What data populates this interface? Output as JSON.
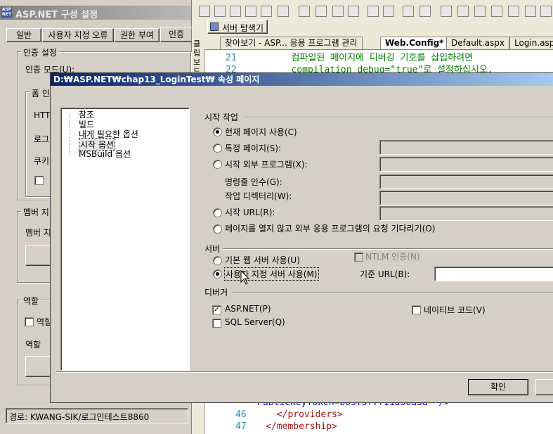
{
  "bg_window": {
    "title": "ASP.NET 구성 설정",
    "tabs": [
      "일반",
      "사용자 지정 오류",
      "권한 부여",
      "인증"
    ],
    "auth_group": "인증 설정",
    "auth_mode_label": "인증 모드(U):",
    "form_group_partial": "폼 인",
    "http_partial": "HTT",
    "login_partial": "로그",
    "cookie_partial": "쿠키",
    "member_group_partial": "멤버 지",
    "member_label_partial": "멤버 지",
    "role_group_partial": "역할",
    "role_check_partial": "역할",
    "role_label_partial": "역할 ",
    "path_status": "경로: KWANG-SIK/로그인테스트8860"
  },
  "editor": {
    "server_explorer_btn": "서버 탐색기",
    "side_label": "클립보드",
    "tabs": [
      "찾아보기 - ASP... 응용 프로그램 관리",
      "Web.Config*",
      "Default.aspx",
      "Login.asp"
    ],
    "top_lines": [
      {
        "num": "21",
        "text": "컴파일된 페이지에 디버깅 기호를 삽입하려면"
      },
      {
        "num": "22",
        "text": "compilation debug=\"true\"로 설정하십시오."
      }
    ],
    "bottom_lines": [
      {
        "num": "",
        "text": "PublicKeyToken=b03f5f7f11d50a3a\" />"
      },
      {
        "num": "46",
        "text": "    </providers>"
      },
      {
        "num": "47",
        "text": "  </membership>"
      }
    ]
  },
  "dialog": {
    "title": "D:₩ASP.NET₩chap13_LoginTest₩ 속성 페이지",
    "tree": [
      "참조",
      "빌드",
      "내게 필요한 옵션",
      "시작 옵션",
      "MSBuild 옵션"
    ],
    "selected_tree_index": 3,
    "start_group": "시작 작업",
    "opt_current": "현재 페이지 사용(C)",
    "opt_specific": "특정 페이지(S):",
    "opt_external": "시작 외부 프로그램(X):",
    "cmd_args": "명령줄 인수(G):",
    "work_dir": "작업 디렉터리(W):",
    "opt_url": "시작 URL(R):",
    "opt_wait": "페이지를 열지 않고 외부 응용 프로그램의 요청 기다리기(O)",
    "server_group": "서버",
    "opt_builtin": "기본 웹 서버 사용(U)",
    "ntlm": "NTLM 인증(N)",
    "opt_custom": "사용자 지정 서버 사용(M)",
    "base_url": "기준 URL(B):",
    "debugger_group": "디버거",
    "dbg_aspnet": "ASP.NET(P)",
    "dbg_native": "네이티브 코드(V)",
    "dbg_sql": "SQL Server(Q)",
    "ok_btn": "확인",
    "selected_start": "current",
    "selected_server": "custom",
    "aspnet_checked": true,
    "native_checked": false,
    "sql_checked": false,
    "ntlm_checked": false
  }
}
